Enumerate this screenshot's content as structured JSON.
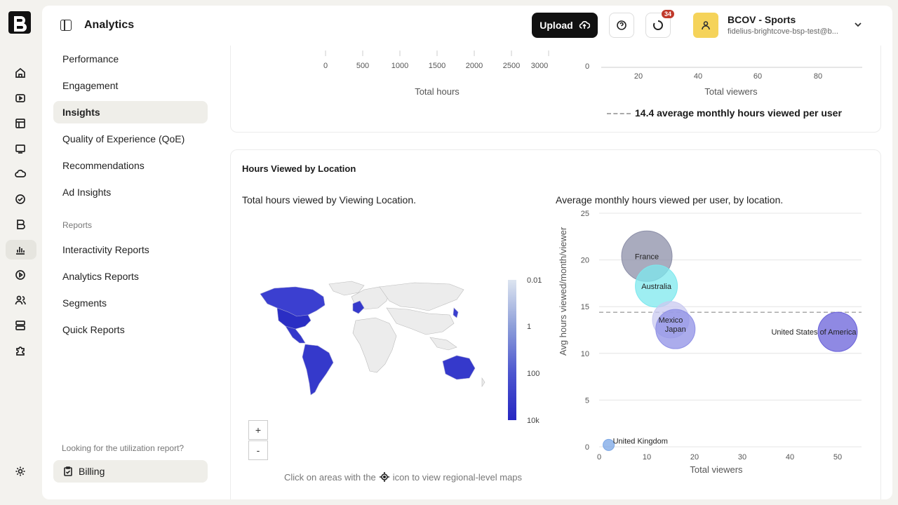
{
  "app": {
    "title": "Analytics"
  },
  "header": {
    "upload_label": "Upload",
    "notification_count": "34",
    "account_name": "BCOV - Sports",
    "account_email": "fidelius-brightcove-bsp-test@b..."
  },
  "nav": {
    "items": [
      {
        "label": "Performance",
        "active": false
      },
      {
        "label": "Engagement",
        "active": false
      },
      {
        "label": "Insights",
        "active": true
      },
      {
        "label": "Quality of Experience (QoE)",
        "active": false
      },
      {
        "label": "Recommendations",
        "active": false
      },
      {
        "label": "Ad Insights",
        "active": false
      }
    ],
    "reports_heading": "Reports",
    "report_items": [
      {
        "label": "Interactivity Reports"
      },
      {
        "label": "Analytics Reports"
      },
      {
        "label": "Segments"
      },
      {
        "label": "Quick Reports"
      }
    ],
    "footer_text": "Looking for the utilization report?",
    "billing_label": "Billing"
  },
  "top_card": {
    "hours_ticks": [
      "0",
      "500",
      "1000",
      "1500",
      "2000",
      "2500",
      "3000"
    ],
    "hours_axis_title": "Total hours",
    "viewers_ticks": [
      "0",
      "20",
      "40",
      "60",
      "80"
    ],
    "viewers_axis_title": "Total viewers",
    "avg_text": "14.4 average monthly hours viewed per user"
  },
  "main_card": {
    "title": "Hours Viewed by Location",
    "map_subtitle": "Total hours viewed by Viewing Location.",
    "colorbar_labels": [
      "0.01",
      "1",
      "100",
      "10k"
    ],
    "zoom_in": "+",
    "zoom_out": "-",
    "map_hint_before": "Click on areas with the",
    "map_hint_after": "icon to view regional-level maps",
    "bubble_subtitle": "Average monthly hours viewed per user, by location.",
    "y_axis_title": "Avg hours viewed/month/viewer",
    "x_axis_title": "Total viewers",
    "avg_text": "14.4 average monthly hours viewed per user"
  },
  "chart_data": {
    "type": "scatter",
    "title": "Average monthly hours viewed per user, by location.",
    "xlabel": "Total viewers",
    "ylabel": "Avg hours viewed/month/viewer",
    "xlim": [
      0,
      55
    ],
    "ylim": [
      0,
      25
    ],
    "x_ticks": [
      0,
      10,
      20,
      30,
      40,
      50
    ],
    "y_ticks": [
      0,
      5,
      10,
      15,
      20,
      25
    ],
    "reference_line": 14.4,
    "points": [
      {
        "label": "France",
        "x": 10,
        "y": 20.4,
        "color": "#8c8fa8",
        "r": 36
      },
      {
        "label": "Australia",
        "x": 12,
        "y": 17.2,
        "color": "#7de8ee",
        "r": 30
      },
      {
        "label": "Mexico",
        "x": 15,
        "y": 13.6,
        "color": "#c9c9f0",
        "r": 26
      },
      {
        "label": "Japan",
        "x": 16,
        "y": 12.6,
        "color": "#8f90e6",
        "r": 28
      },
      {
        "label": "United States of America",
        "x": 50,
        "y": 12.3,
        "color": "#6a62d9",
        "r": 28
      },
      {
        "label": "United Kingdom",
        "x": 2,
        "y": 0.2,
        "color": "#7aa6e6",
        "r": 8
      }
    ]
  }
}
